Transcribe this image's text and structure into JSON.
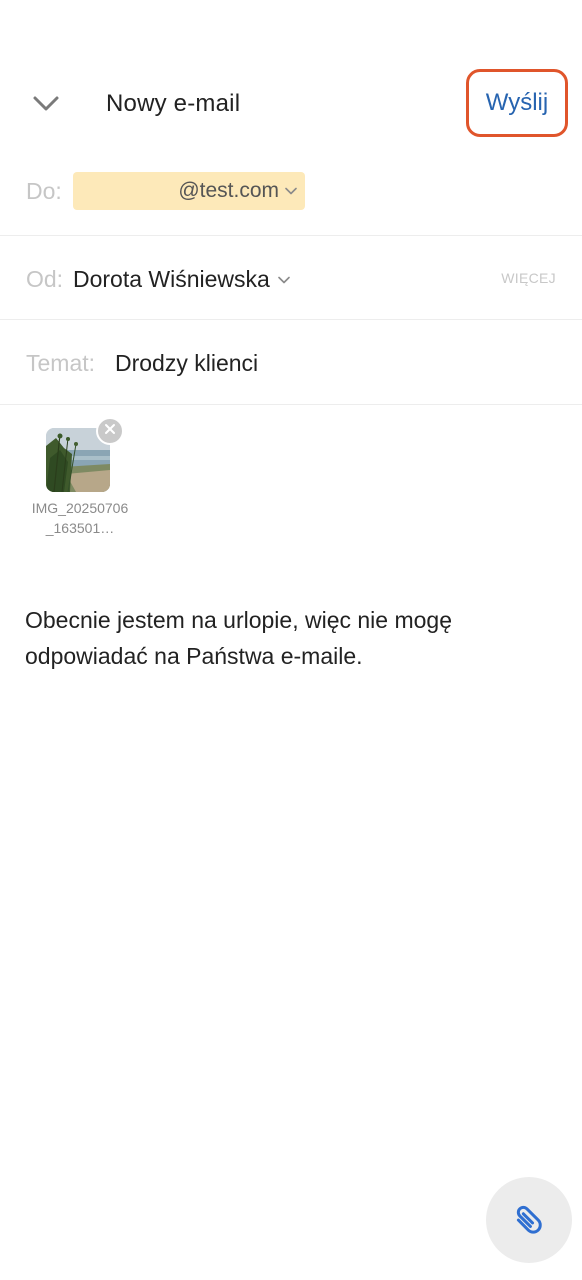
{
  "header": {
    "back_icon": "chevron-down-icon",
    "title": "Nowy e-mail",
    "send_label": "Wyślij",
    "send_highlight_color": "#e0552b",
    "accent_color": "#2764b0"
  },
  "to": {
    "label": "Do:",
    "recipient": "@test.com",
    "recipient_chip_color": "#fde9b9"
  },
  "from": {
    "label": "Od:",
    "value": "Dorota Wiśniewska",
    "more_label": "WIĘCEJ"
  },
  "subject": {
    "label": "Temat:",
    "value": "Drodzy klienci"
  },
  "attachment": {
    "name": "IMG_20250706_163501…",
    "remove_icon": "close-icon"
  },
  "message": {
    "body": "Obecnie jestem na urlopie, więc nie mogę odpowiadać na Państwa e-maile."
  },
  "fab": {
    "icon": "paperclip-icon"
  }
}
